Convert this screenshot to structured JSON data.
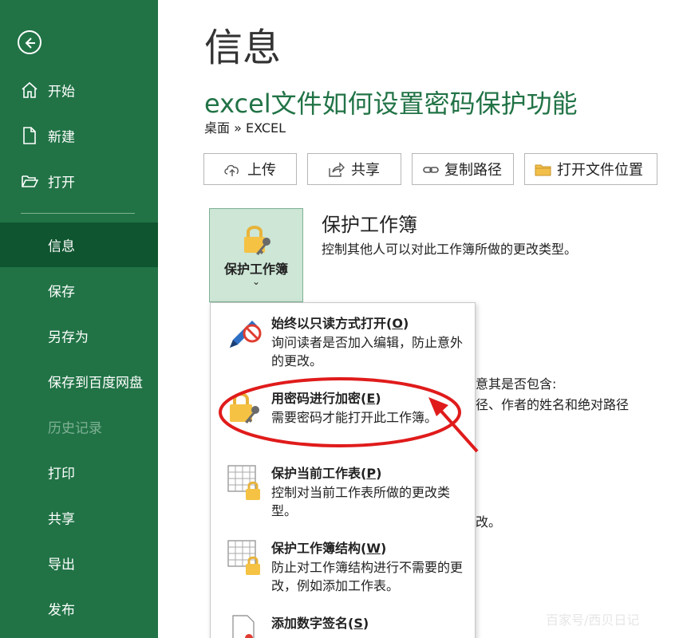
{
  "sidebar": {
    "items": [
      {
        "label": "开始"
      },
      {
        "label": "新建"
      },
      {
        "label": "打开"
      },
      {
        "label": "信息"
      },
      {
        "label": "保存"
      },
      {
        "label": "另存为"
      },
      {
        "label": "保存到百度网盘"
      },
      {
        "label": "历史记录"
      },
      {
        "label": "打印"
      },
      {
        "label": "共享"
      },
      {
        "label": "导出"
      },
      {
        "label": "发布"
      }
    ]
  },
  "main": {
    "page_title": "信息",
    "doc_title": "excel文件如何设置密码保护功能",
    "doc_path": "桌面 » EXCEL",
    "actions": [
      {
        "label": "上传"
      },
      {
        "label": "共享"
      },
      {
        "label": "复制路径"
      },
      {
        "label": "打开文件位置"
      }
    ],
    "protect": {
      "tile_label": "保护工作簿",
      "chevron": "⌄",
      "title": "保护工作簿",
      "desc": "控制其他人可以对此工作簿所做的更改类型。"
    },
    "partial_text": {
      "line1": "意其是否包含:",
      "line2": "径、作者的姓名和绝对路径",
      "line3": "改。"
    }
  },
  "dropdown": {
    "items": [
      {
        "title": "始终以只读方式打开(",
        "key": "O",
        "title_end": ")",
        "desc": "询问读者是否加入编辑，防止意外的更改。"
      },
      {
        "title": "用密码进行加密(",
        "key": "E",
        "title_end": ")",
        "desc": "需要密码才能打开此工作簿。"
      },
      {
        "title": "保护当前工作表(",
        "key": "P",
        "title_end": ")",
        "desc": "控制对当前工作表所做的更改类型。"
      },
      {
        "title": "保护工作簿结构(",
        "key": "W",
        "title_end": ")",
        "desc": "防止对工作簿结构进行不需要的更改，例如添加工作表。"
      },
      {
        "title": "添加数字签名(",
        "key": "S",
        "title_end": ")",
        "desc": ""
      }
    ]
  },
  "watermark": "百家号/西贝日记",
  "colors": {
    "accent": "#217346",
    "active": "#0f5530",
    "highlight": "#e01b1b"
  }
}
